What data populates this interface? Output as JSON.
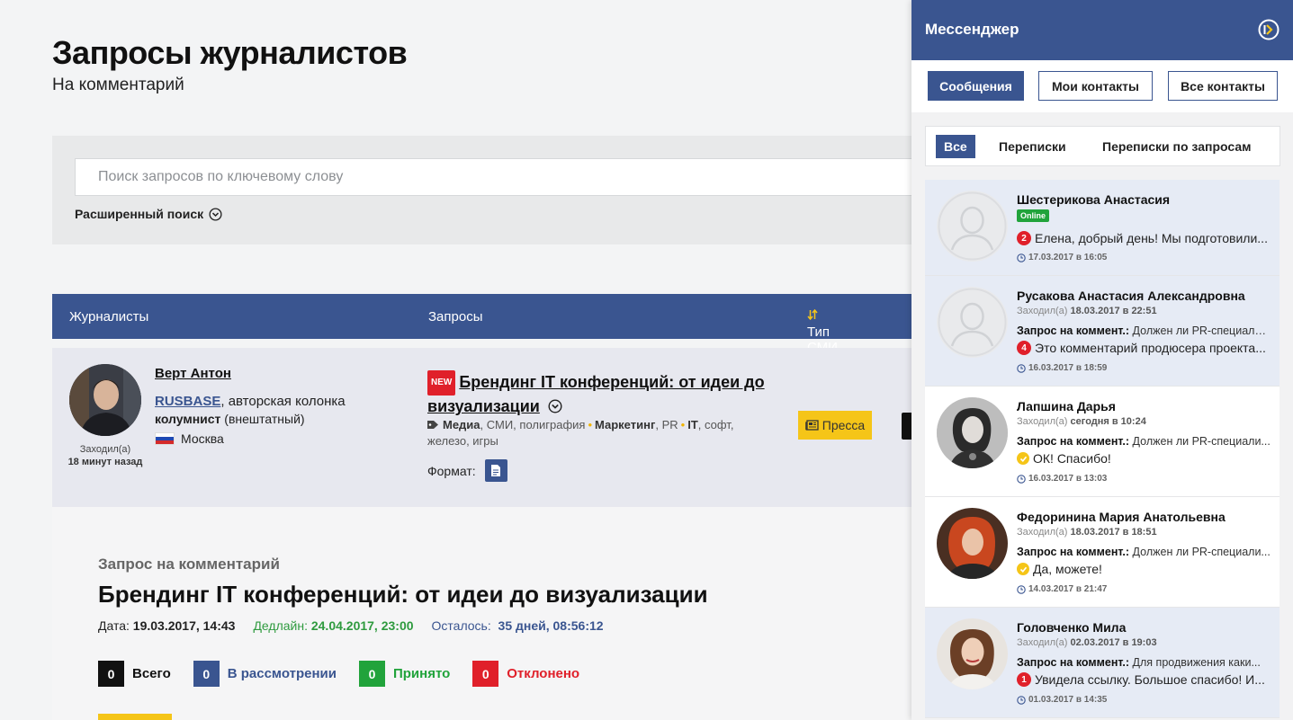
{
  "page": {
    "title": "Запросы журналистов",
    "subtitle": "На комментарий"
  },
  "search": {
    "placeholder": "Поиск запросов по ключевому слову",
    "advanced_label": "Расширенный поиск"
  },
  "table": {
    "headers": [
      "Журналисты",
      "Запросы",
      "Тип СМИ"
    ]
  },
  "row": {
    "journalist_name": "Верт Антон",
    "media_name": "RUSBASE",
    "media_rest": ", авторская колонка",
    "role": "колумнист",
    "role_note": "(внештатный)",
    "city": "Москва",
    "visited_label": "Заходил(а)",
    "visited_time": "18 минут назад",
    "new_badge": "NEW",
    "request_title": "Брендинг IT конференций: от идеи до визуализации",
    "tag1_bold": "Медиа",
    "tag1_rest": ", СМИ, полиграфия",
    "tag2_bold": "Маркетинг",
    "tag2_rest": ", PR",
    "tag3_bold": "IT",
    "tag3_rest": ", софт, железо, игры",
    "format_label": "Формат:",
    "media_type_button": "Пресса"
  },
  "detail": {
    "kind": "Запрос на комментарий",
    "title": "Брендинг IT конференций: от идеи до визуализации",
    "date_label": "Дата:",
    "date_value": "19.03.2017, 14:43",
    "deadline_label": "Дедлайн:",
    "deadline_value": "24.04.2017, 23:00",
    "left_label": "Осталось:",
    "left_value": "35 дней, 08:56:12",
    "stats": [
      {
        "count": "0",
        "label": "Всего",
        "color": "#111111"
      },
      {
        "count": "0",
        "label": "В рассмотрении",
        "color": "#3a5590"
      },
      {
        "count": "0",
        "label": "Принято",
        "color": "#21a33b"
      },
      {
        "count": "0",
        "label": "Отклонено",
        "color": "#e0202a"
      }
    ]
  },
  "messenger": {
    "title": "Мессенджер",
    "tabs": [
      "Сообщения",
      "Мои контакты",
      "Все контакты"
    ],
    "filters": [
      "Все",
      "Переписки",
      "Переписки по запросам"
    ],
    "conversations": [
      {
        "name": "Шестерикова Анастасия",
        "online": "Online",
        "unread": "2",
        "message": "Елена, добрый день! Мы подготовили...",
        "time": "17.03.2017 в 16:05"
      },
      {
        "name": "Русакова Анастасия Александровна",
        "visited_label": "Заходил(а)",
        "visited_time": "18.03.2017 в 22:51",
        "req_label": "Запрос на коммент.:",
        "req_text": "Должен ли PR-специалист...",
        "unread": "4",
        "message": "Это комментарий продюсера проекта...",
        "time": "16.03.2017 в 18:59"
      },
      {
        "name": "Лапшина Дарья",
        "visited_label": "Заходил(а)",
        "visited_time": "сегодня в 10:24",
        "req_label": "Запрос на коммент.:",
        "req_text": "Должен ли PR-специали...",
        "message": "ОК! Спасибо!",
        "time": "16.03.2017 в 13:03"
      },
      {
        "name": "Федоринина Мария Анатольевна",
        "visited_label": "Заходил(а)",
        "visited_time": "18.03.2017 в 18:51",
        "req_label": "Запрос на коммент.:",
        "req_text": "Должен ли PR-специали...",
        "message": "Да, можете!",
        "time": "14.03.2017 в 21:47"
      },
      {
        "name": "Головченко Мила",
        "visited_label": "Заходил(а)",
        "visited_time": "02.03.2017 в 19:03",
        "req_label": "Запрос на коммент.:",
        "req_text": "Для продвижения каки...",
        "unread": "1",
        "message": "Увидела ссылку. Большое спасибо! И...",
        "time": "01.03.2017 в 14:35"
      }
    ]
  },
  "icons": {
    "chevron": "circle-chevron-down-icon",
    "tag": "tag-icon",
    "document": "document-icon",
    "newspaper": "newspaper-icon",
    "sort": "sort-arrows-icon",
    "close": "circle-arrow-right-icon",
    "clock": "clock-icon",
    "check": "check-icon"
  },
  "colors": {
    "brand": "#3a5590",
    "accent_yellow": "#f5c518",
    "success": "#21a33b",
    "danger": "#e0202a"
  }
}
